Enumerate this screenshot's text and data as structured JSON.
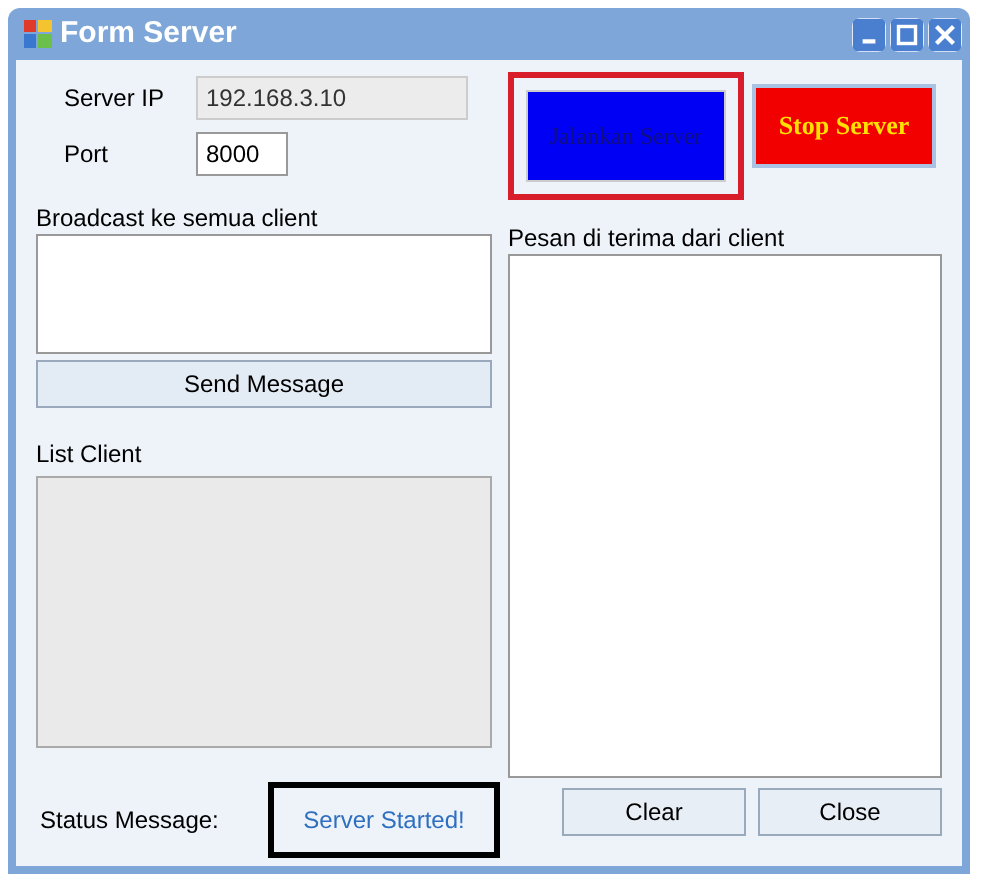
{
  "window": {
    "title": "Form Server"
  },
  "server_ip": {
    "label": "Server IP",
    "value": "192.168.3.10",
    "disabled": true
  },
  "port": {
    "label": "Port",
    "value": "8000"
  },
  "start_button": {
    "label": "Jalankan Server",
    "disabled": true
  },
  "stop_button": {
    "label": "Stop Server",
    "disabled": false
  },
  "broadcast": {
    "label": "Broadcast ke semua client",
    "send_button": "Send Message"
  },
  "list_client": {
    "label": "List Client"
  },
  "received": {
    "label": "Pesan di terima dari client"
  },
  "status": {
    "label": "Status Message:",
    "value": "Server Started!"
  },
  "buttons": [
    "Clear",
    "Close"
  ]
}
